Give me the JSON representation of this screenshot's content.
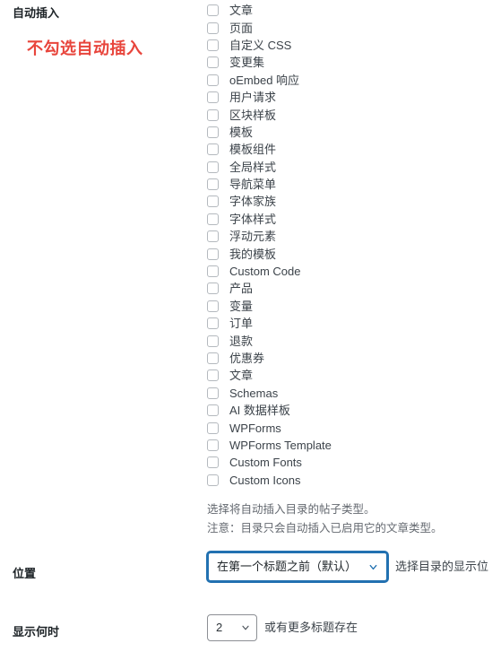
{
  "auto_insert": {
    "label": "自动插入",
    "annotation": "不勾选自动插入",
    "post_types": [
      "文章",
      "页面",
      "自定义 CSS",
      "变更集",
      "oEmbed 响应",
      "用户请求",
      "区块样板",
      "模板",
      "模板组件",
      "全局样式",
      "导航菜单",
      "字体家族",
      "字体样式",
      "浮动元素",
      "我的模板",
      "Custom Code",
      "产品",
      "变量",
      "订单",
      "退款",
      "优惠券",
      "文章",
      "Schemas",
      "AI 数据样板",
      "WPForms",
      "WPForms Template",
      "Custom Fonts",
      "Custom Icons"
    ],
    "helper_line_1": "选择将自动插入目录的帖子类型。",
    "helper_line_2": "注意：目录只会自动插入已启用它的文章类型。"
  },
  "position": {
    "label": "位置",
    "selected": "在第一个标题之前（默认）",
    "description": "选择目录的显示位"
  },
  "display_when": {
    "label": "显示何时",
    "selected": "2",
    "description": "或有更多标题存在"
  },
  "colors": {
    "annotation_red": "#e8453c",
    "focus_blue": "#2271b1",
    "label_dark": "#1d2327",
    "helper_gray": "#646970",
    "checkbox_border": "#b4b9be"
  }
}
